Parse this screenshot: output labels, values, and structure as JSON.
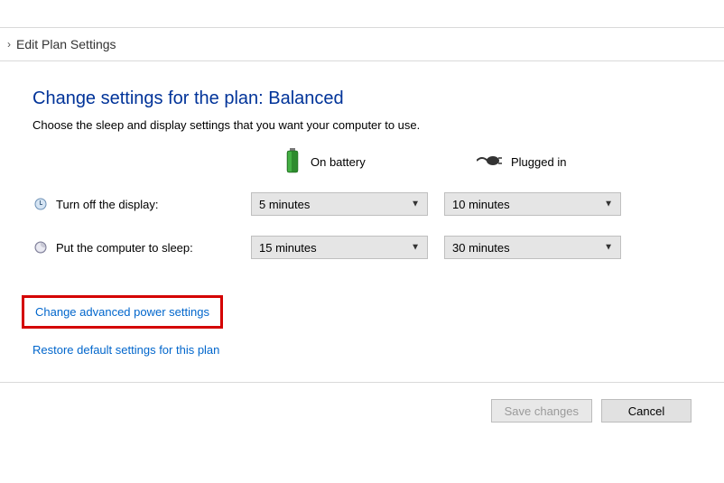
{
  "breadcrumb": {
    "label": "Edit Plan Settings"
  },
  "heading": "Change settings for the plan: Balanced",
  "subheading": "Choose the sleep and display settings that you want your computer to use.",
  "columns": {
    "battery": "On battery",
    "plugged": "Plugged in"
  },
  "rows": {
    "display": {
      "label": "Turn off the display:",
      "battery_value": "5 minutes",
      "plugged_value": "10 minutes"
    },
    "sleep": {
      "label": "Put the computer to sleep:",
      "battery_value": "15 minutes",
      "plugged_value": "30 minutes"
    }
  },
  "links": {
    "advanced": "Change advanced power settings",
    "restore": "Restore default settings for this plan"
  },
  "buttons": {
    "save": "Save changes",
    "cancel": "Cancel"
  }
}
